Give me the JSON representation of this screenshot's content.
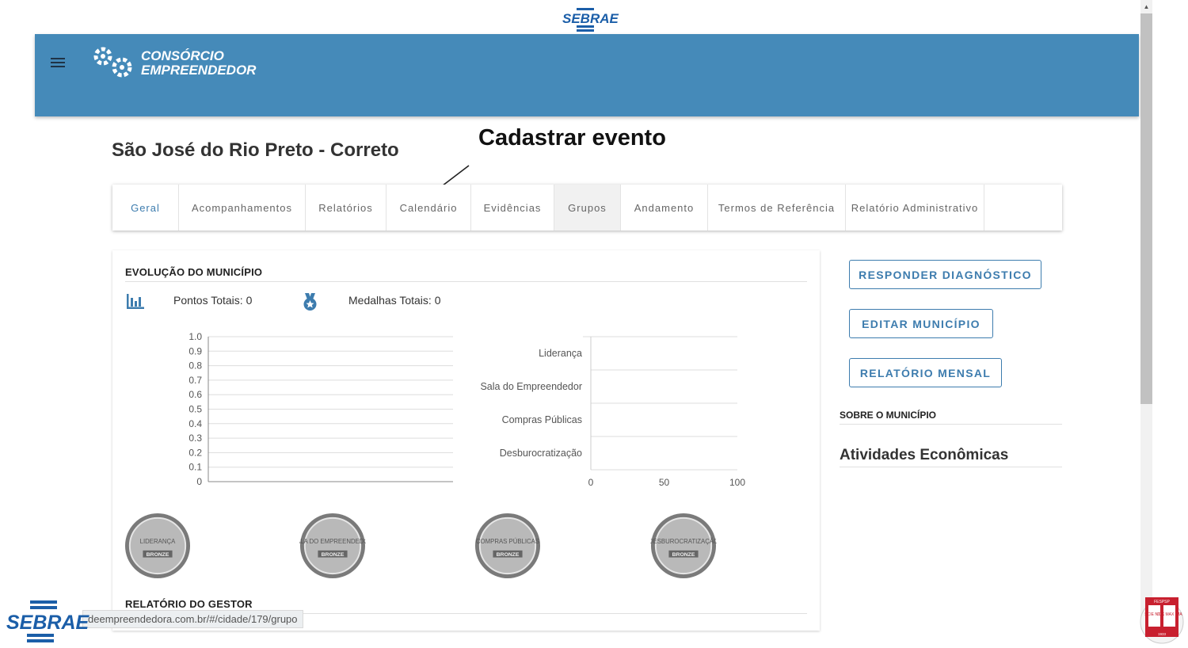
{
  "brand": {
    "sebrae": "SEBRAE",
    "logo_line1": "CONSÓRCIO",
    "logo_line2": "EMPREENDEDOR",
    "header_color": "#458ab9"
  },
  "page": {
    "title": "São José do Rio Preto - Correto",
    "annotation": "Cadastrar evento"
  },
  "tabs": [
    {
      "label": "Geral"
    },
    {
      "label": "Acompanhamentos"
    },
    {
      "label": "Relatórios"
    },
    {
      "label": "Calendário"
    },
    {
      "label": "Evidências"
    },
    {
      "label": "Grupos"
    },
    {
      "label": "Andamento"
    },
    {
      "label": "Termos de Referência"
    },
    {
      "label": "Relatório Administrativo"
    }
  ],
  "evolution": {
    "title": "EVOLUÇÃO DO MUNICÍPIO",
    "points_label": "Pontos Totais: 0",
    "medals_label": "Medalhas Totais: 0"
  },
  "chart_data": [
    {
      "type": "line",
      "y_ticks": [
        "1.0",
        "0.9",
        "0.8",
        "0.7",
        "0.6",
        "0.5",
        "0.4",
        "0.3",
        "0.2",
        "0.1",
        "0"
      ],
      "ylim": [
        0,
        1
      ],
      "series": [],
      "grid": true
    },
    {
      "type": "bar",
      "orientation": "horizontal",
      "categories": [
        "Liderança",
        "Sala do Empreendedor",
        "Compras Públicas",
        "Desburocratização"
      ],
      "values": [
        0,
        0,
        0,
        0
      ],
      "x_ticks": [
        "0",
        "50",
        "100"
      ],
      "xlim": [
        0,
        100
      ],
      "grid": true
    }
  ],
  "medals": [
    {
      "line1": "LIDERANÇA",
      "level": "BRONZE"
    },
    {
      "line1": "SALA DO EMPREENDEDOR",
      "level": "BRONZE"
    },
    {
      "line1": "COMPRAS PÚBLICAS",
      "level": "BRONZE"
    },
    {
      "line1": "DESBUROCRATIZAÇÃO",
      "level": "BRONZE"
    }
  ],
  "gestor": {
    "title": "RELATÓRIO DO GESTOR"
  },
  "actions": {
    "diagnostico": "RESPONDER DIAGNÓSTICO",
    "editar": "EDITAR MUNICÍPIO",
    "mensal": "RELATÓRIO MENSAL"
  },
  "about": {
    "title": "SOBRE O MUNICÍPIO",
    "activities": "Atividades Econômicas"
  },
  "status": {
    "url": "deempreendedora.com.br/#/cidade/179/grupo"
  },
  "footer": {
    "fespsp_top": "FESPSP",
    "seal_text_a": "SCIE NTIA",
    "seal_text_b": "LUX MAX IMA",
    "seal_year": "1933"
  }
}
